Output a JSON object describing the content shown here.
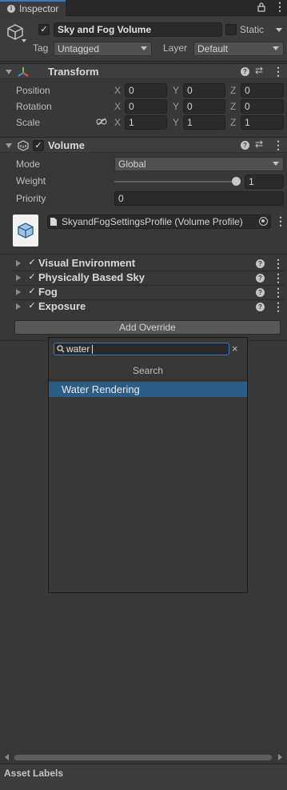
{
  "tab": {
    "title": "Inspector",
    "info_icon": "info-icon",
    "lock_icon": "lock-icon",
    "menu_icon": "kebab-menu-icon"
  },
  "header": {
    "object_name": "Sky and Fog Volume",
    "active_checked": true,
    "static_label": "Static",
    "tag_label": "Tag",
    "tag_value": "Untagged",
    "layer_label": "Layer",
    "layer_value": "Default"
  },
  "transform": {
    "title": "Transform",
    "rows": [
      {
        "label": "Position",
        "x": "0",
        "y": "0",
        "z": "0"
      },
      {
        "label": "Rotation",
        "x": "0",
        "y": "0",
        "z": "0"
      },
      {
        "label": "Scale",
        "x": "1",
        "y": "1",
        "z": "1"
      }
    ],
    "axes": {
      "x": "X",
      "y": "Y",
      "z": "Z"
    }
  },
  "volume": {
    "title": "Volume",
    "enabled": true,
    "mode_label": "Mode",
    "mode_value": "Global",
    "weight_label": "Weight",
    "weight_value": "1",
    "weight_fraction": 1.0,
    "priority_label": "Priority",
    "priority_value": "0",
    "profile_value": "SkyandFogSettingsProfile (Volume Profile)"
  },
  "overrides": [
    {
      "label": "Visual Environment",
      "checked": true
    },
    {
      "label": "Physically Based Sky",
      "checked": true
    },
    {
      "label": "Fog",
      "checked": true
    },
    {
      "label": "Exposure",
      "checked": true
    }
  ],
  "add_override_label": "Add Override",
  "popup": {
    "search_value": "water",
    "section_label": "Search",
    "results": [
      "Water Rendering"
    ],
    "clear_icon": "×"
  },
  "footer": {
    "asset_labels": "Asset Labels"
  },
  "colors": {
    "accent": "#3a79bb",
    "selection": "#2c5d87",
    "panel": "#383838"
  }
}
